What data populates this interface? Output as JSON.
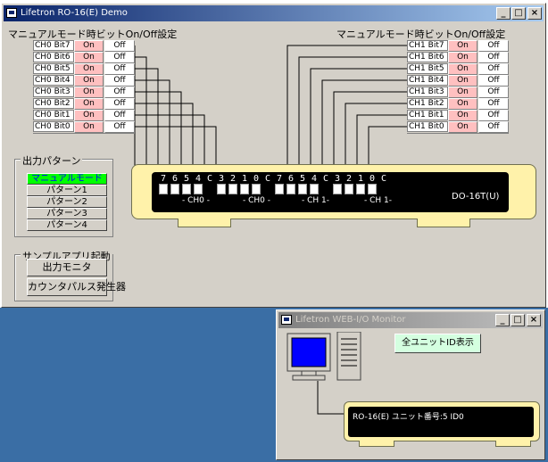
{
  "main_window": {
    "title": "Lifetron RO-16(E) Demo",
    "minimize": "_",
    "maximize": "□",
    "close": "×"
  },
  "manual_label_left": "マニュアルモード時ビットOn/Off設定",
  "manual_label_right": "マニュアルモード時ビットOn/Off設定",
  "ch0_bits": [
    {
      "name": "CH0 Bit7",
      "on": "On",
      "off": "Off"
    },
    {
      "name": "CH0 Bit6",
      "on": "On",
      "off": "Off"
    },
    {
      "name": "CH0 Bit5",
      "on": "On",
      "off": "Off"
    },
    {
      "name": "CH0 Bit4",
      "on": "On",
      "off": "Off"
    },
    {
      "name": "CH0 Bit3",
      "on": "On",
      "off": "Off"
    },
    {
      "name": "CH0 Bit2",
      "on": "On",
      "off": "Off"
    },
    {
      "name": "CH0 Bit1",
      "on": "On",
      "off": "Off"
    },
    {
      "name": "CH0 Bit0",
      "on": "On",
      "off": "Off"
    }
  ],
  "ch1_bits": [
    {
      "name": "CH1 Bit7",
      "on": "On",
      "off": "Off"
    },
    {
      "name": "CH1 Bit6",
      "on": "On",
      "off": "Off"
    },
    {
      "name": "CH1 Bit5",
      "on": "On",
      "off": "Off"
    },
    {
      "name": "CH1 Bit4",
      "on": "On",
      "off": "Off"
    },
    {
      "name": "CH1 Bit3",
      "on": "On",
      "off": "Off"
    },
    {
      "name": "CH1 Bit2",
      "on": "On",
      "off": "Off"
    },
    {
      "name": "CH1 Bit1",
      "on": "On",
      "off": "Off"
    },
    {
      "name": "CH1 Bit0",
      "on": "On",
      "off": "Off"
    }
  ],
  "pattern_group": {
    "title": "出力パターン",
    "buttons": [
      "マニュアルモード",
      "パターン1",
      "パターン2",
      "パターン3",
      "パターン4"
    ],
    "selected_index": 0
  },
  "sample_group": {
    "title": "サンプルアプリ起動",
    "buttons": [
      "出力モニタ",
      "カウンタパルス発生器"
    ]
  },
  "device": {
    "digits": [
      "7",
      "6",
      "5",
      "4",
      "C",
      "3",
      "2",
      "1",
      "0",
      "C",
      "7",
      "6",
      "5",
      "4",
      "C",
      "3",
      "2",
      "1",
      "0",
      "C"
    ],
    "channel_labels": [
      "- CH0 -",
      "- CH0 -",
      "- CH 1-",
      "- CH 1-"
    ],
    "model": "DO-16T(U)"
  },
  "monitor_window": {
    "title": "Lifetron WEB-I/O Monitor",
    "minimize": "_",
    "maximize": "□",
    "close": "×",
    "show_all_button": "全ユニットID表示",
    "device_text": "RO-16(E)    ユニット番号:5  ID0"
  },
  "colors": {
    "on_button": "#ffc0c0",
    "selected_pattern": "#00ff00",
    "device_body": "#fff2aa",
    "title_active": "#0a246a",
    "desktop": "#3a6ea5"
  }
}
